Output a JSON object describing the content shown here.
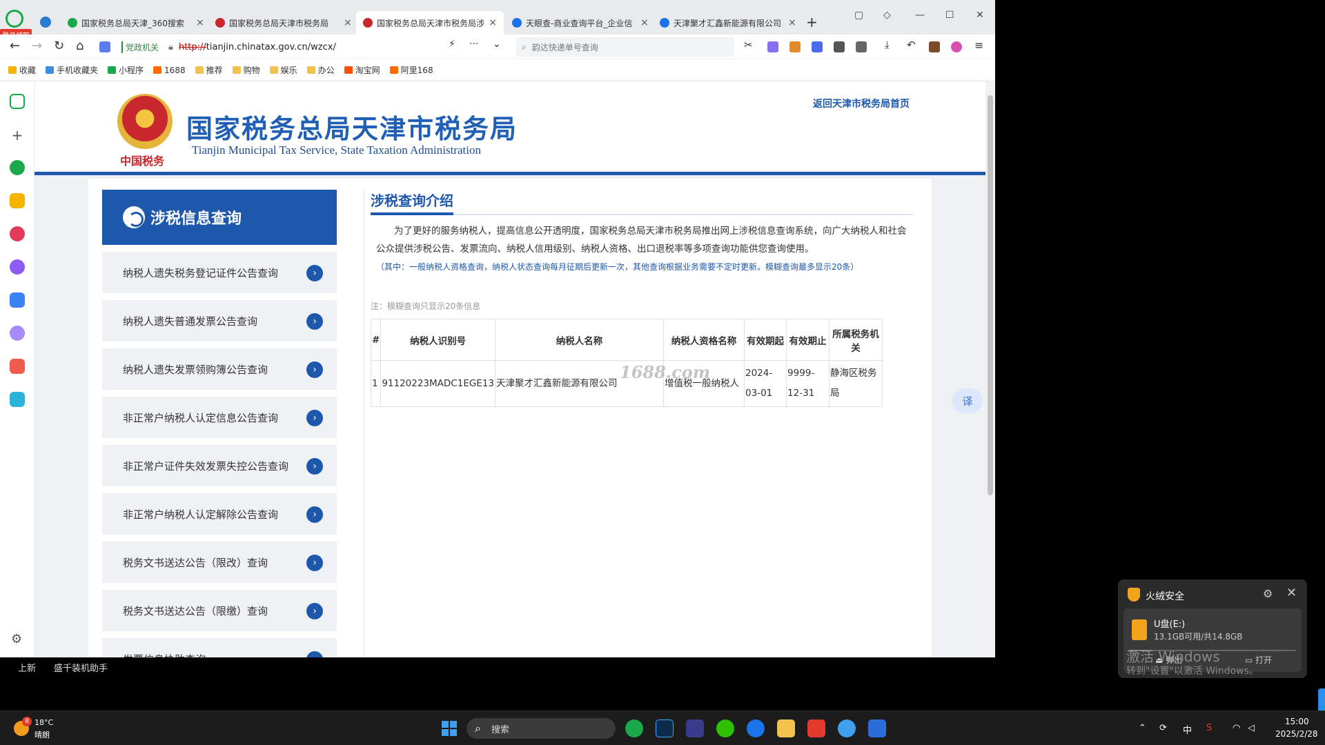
{
  "browser": {
    "badge": "登录领取",
    "tabs": [
      {
        "title": "国家税务总局天津_360搜索",
        "favicon_color": "#19a84a"
      },
      {
        "title": "国家税务总局天津市税务局",
        "favicon_color": "#c8272d"
      },
      {
        "title": "国家税务总局天津市税务局涉",
        "favicon_color": "#c8272d"
      },
      {
        "title": "天眼查-商业查询平台_企业信",
        "favicon_color": "#1a73e8"
      },
      {
        "title": "天津聚才汇鑫新能源有限公司",
        "favicon_color": "#1a73e8"
      }
    ],
    "active_tab": 2,
    "new_tab": "+",
    "url_tag": "党政机关",
    "url_proto": "http://",
    "url_rest": "tianjin.chinatax.gov.cn/wzcx/",
    "search_placeholder": "韵达快递单号查询",
    "bookmarks": [
      {
        "label": "收藏",
        "color": "#f4b400"
      },
      {
        "label": "手机收藏夹",
        "color": "#3c8dde"
      },
      {
        "label": "小程序",
        "color": "#19a84a"
      },
      {
        "label": "1688",
        "color": "#ff6a00"
      },
      {
        "label": "推荐",
        "color": "#f2c14e"
      },
      {
        "label": "购物",
        "color": "#f2c14e"
      },
      {
        "label": "娱乐",
        "color": "#f2c14e"
      },
      {
        "label": "办公",
        "color": "#f2c14e"
      },
      {
        "label": "淘宝网",
        "color": "#ff5000"
      },
      {
        "label": "阿里168",
        "color": "#ff6a00"
      }
    ]
  },
  "site": {
    "emblem_text": "中国税务",
    "title": "国家税务总局天津市税务局",
    "subtitle": "Tianjin Municipal Tax Service, State Taxation Administration",
    "home_link": "返回天津市税务局首页"
  },
  "sidebar": {
    "title": "涉税信息查询",
    "items": [
      {
        "label": "纳税人遗失税务登记证件公告查询"
      },
      {
        "label": "纳税人遗失普通发票公告查询"
      },
      {
        "label": "纳税人遗失发票领购簿公告查询"
      },
      {
        "label": "非正常户纳税人认定信息公告查询"
      },
      {
        "label": "非正常户证件失效发票失控公告查询"
      },
      {
        "label": "非正常户纳税人认定解除公告查询"
      },
      {
        "label": "税务文书送达公告（限改）查询"
      },
      {
        "label": "税务文书送达公告（限缴）查询"
      },
      {
        "label": "发票信息协助查询"
      }
    ],
    "arrow": "›"
  },
  "main": {
    "title": "涉税查询介绍",
    "intro": "为了更好的服务纳税人，提高信息公开透明度，国家税务总局天津市税务局推出网上涉税信息查询系统，向广大纳税人和社会公众提供涉税公告、发票流向、纳税人信用级别、纳税人资格、出口退税率等多项查询功能供您查询使用。",
    "intro_note": "（其中：一般纳税人资格查询，纳税人状态查询每月征期后更新一次，其他查询根据业务需要不定时更新。模糊查询最多显示20条）",
    "fuzzy_note": "注：模糊查询只显示20条信息",
    "table": {
      "headers": [
        "#",
        "纳税人识别号",
        "纳税人名称",
        "纳税人资格名称",
        "有效期起",
        "有效期止",
        "所属税务机关"
      ],
      "rows": [
        [
          "1",
          "91120223MADC1EGE13",
          "天津聚才汇鑫新能源有限公司",
          "增值税一般纳税人",
          "2024-03-01",
          "9999-12-31",
          "静海区税务局"
        ]
      ]
    },
    "watermark": "1688.com",
    "translate": "译"
  },
  "below": {
    "label1": "上新",
    "label2": "盛千装机助手"
  },
  "popup": {
    "title": "火绒安全",
    "device_name": "U盘(E:)",
    "device_space": "13.1GB可用/共14.8GB",
    "used_fraction": 0.115,
    "eject": "弹出",
    "open": "打开"
  },
  "activation": {
    "title": "激活 Windows",
    "subtitle": "转到\"设置\"以激活 Windows。"
  },
  "taskbar": {
    "weather_badge": "8",
    "temperature": "18°C",
    "weather": "晴朗",
    "search_label": "搜索",
    "ime": "中",
    "time": "15:00",
    "date": "2025/2/28"
  }
}
